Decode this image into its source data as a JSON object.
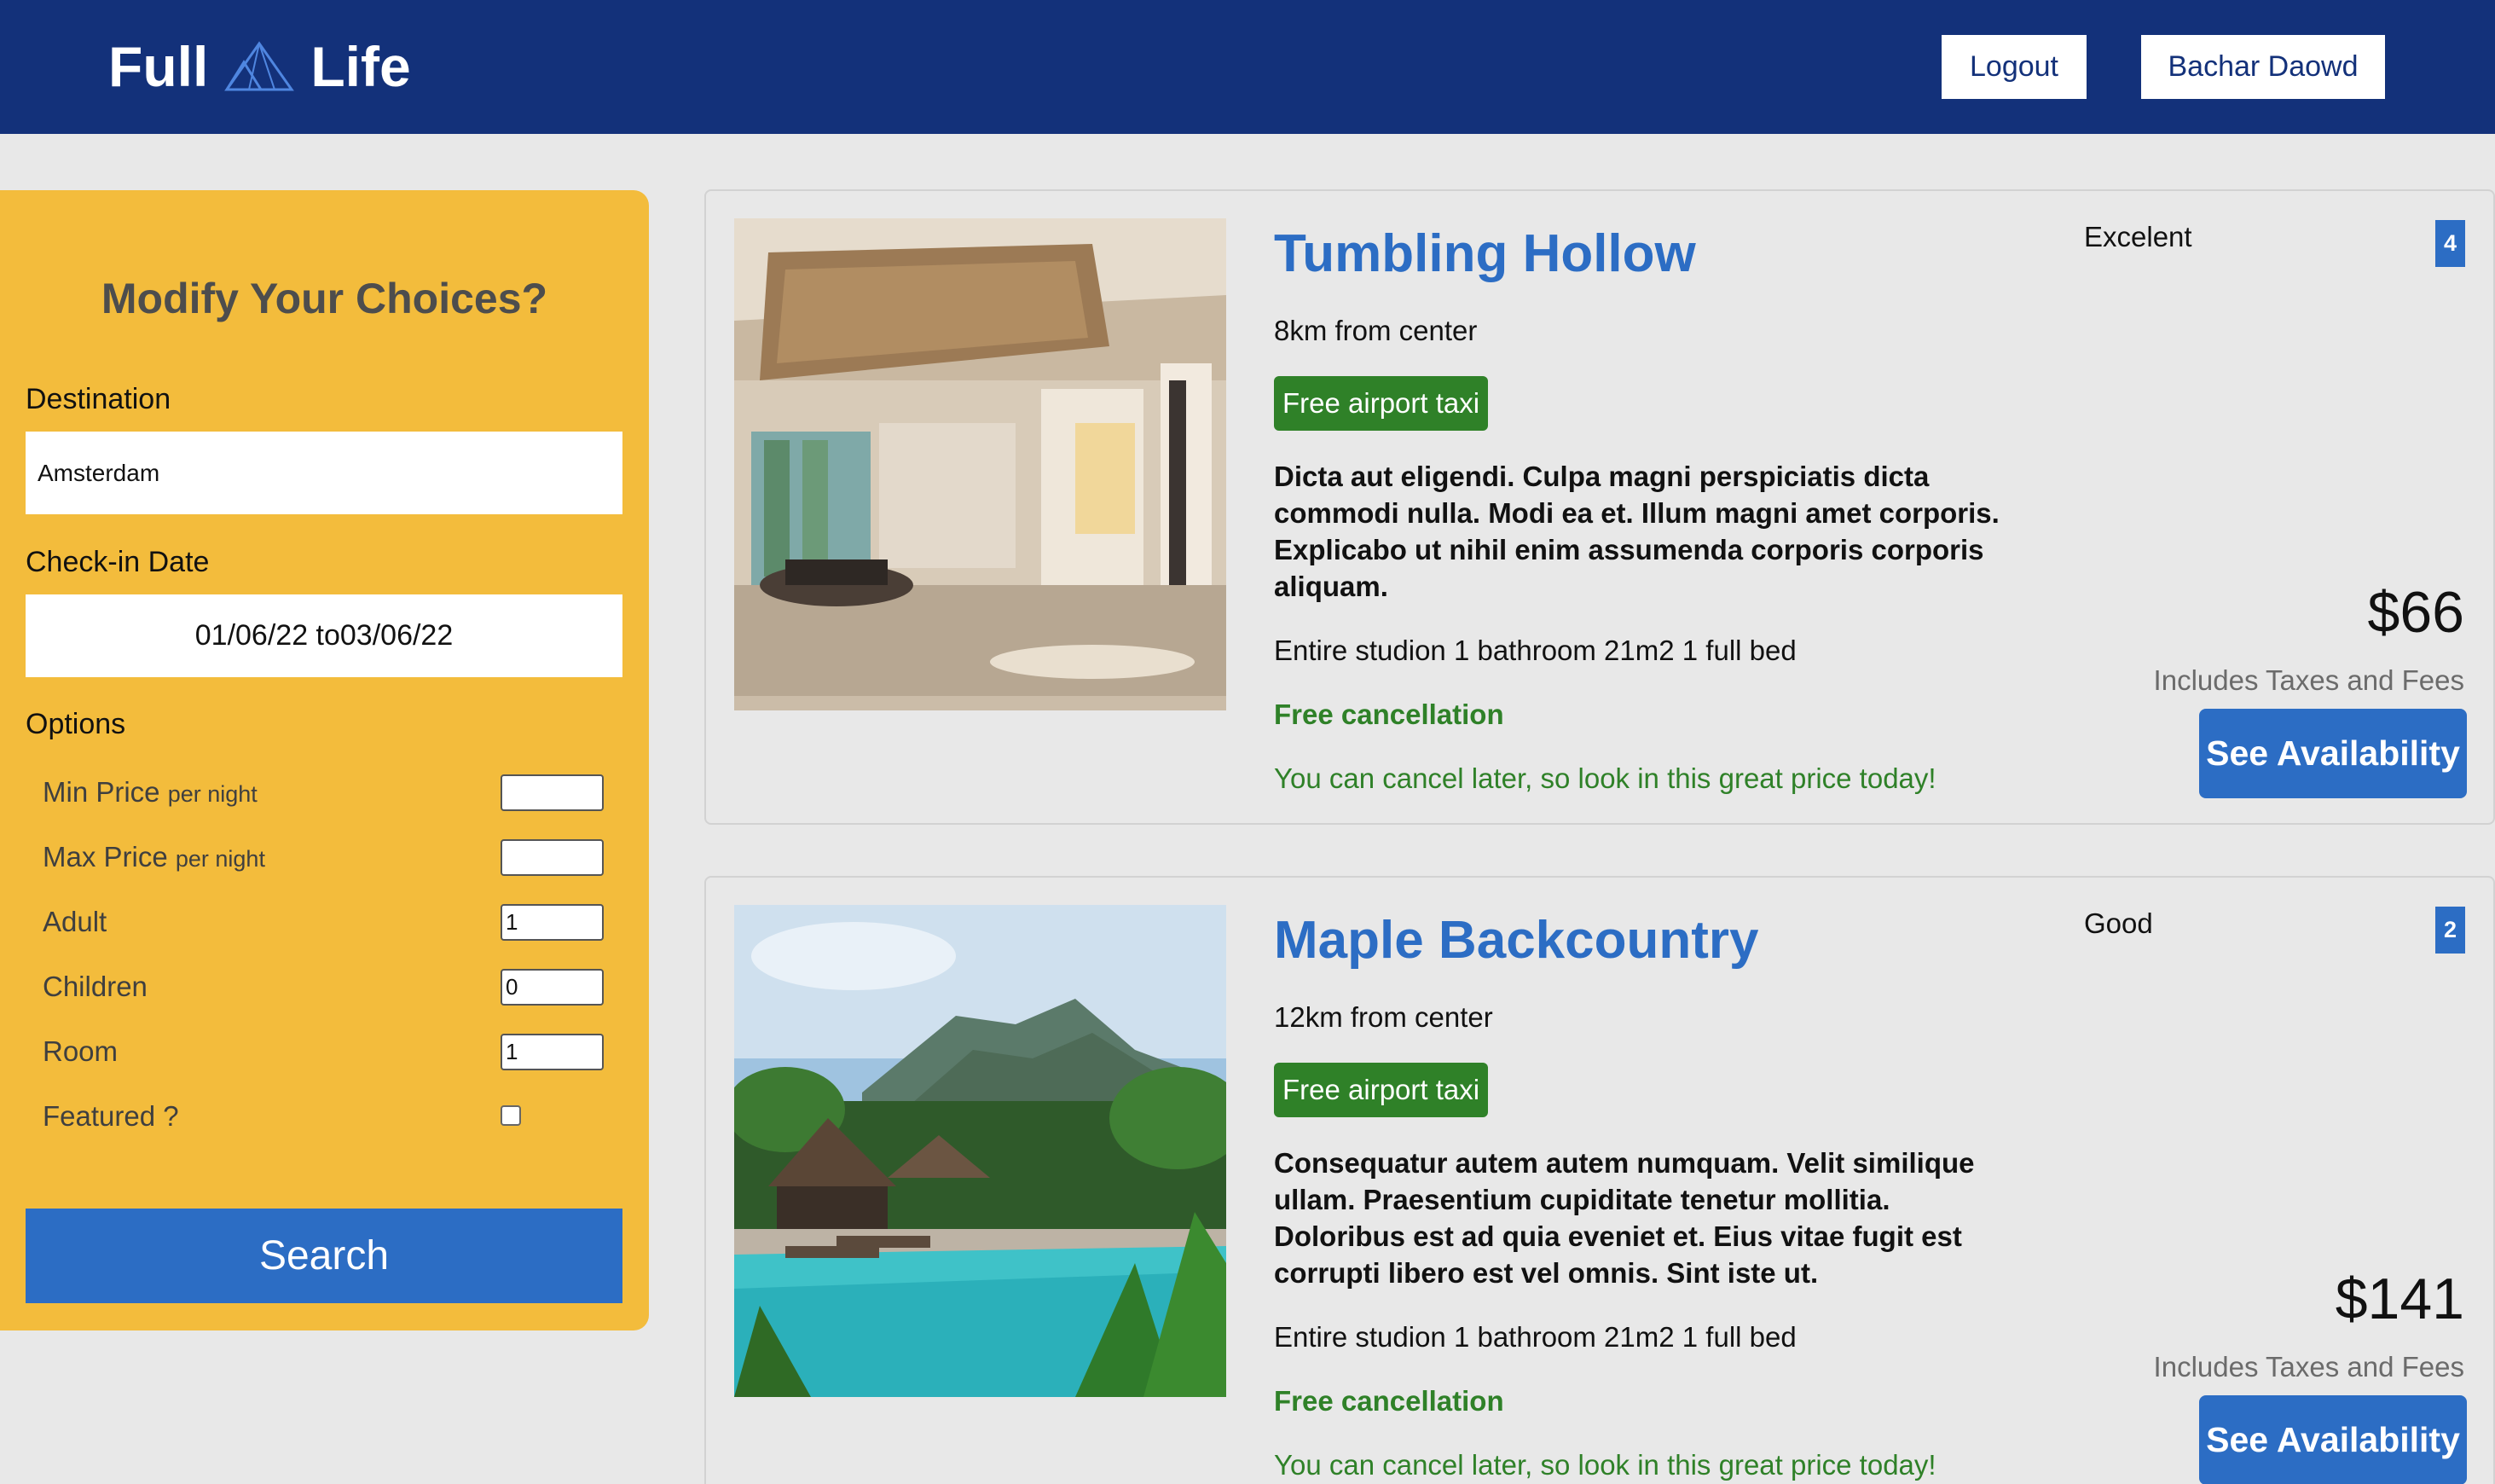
{
  "header": {
    "logo_left": "Full",
    "logo_right": "Life",
    "logout_label": "Logout",
    "user_label": "Bachar Daowd",
    "bg_color": "#13317a"
  },
  "sidebar": {
    "title": "Modify Your Choices?",
    "destination_label": "Destination",
    "destination_value": "Amsterdam",
    "checkin_label": "Check-in Date",
    "checkin_value": "01/06/22 to03/06/22",
    "options_label": "Options",
    "options": [
      {
        "label": "Min Price",
        "suffix": "per night",
        "value": ""
      },
      {
        "label": "Max Price",
        "suffix": "per night",
        "value": ""
      },
      {
        "label": "Adult",
        "value": "1"
      },
      {
        "label": "Children",
        "value": "0"
      },
      {
        "label": "Room",
        "value": "1"
      },
      {
        "label": "Featured ?",
        "checked": false
      }
    ],
    "search_label": "Search",
    "bg_color": "#f3bc3c"
  },
  "results": [
    {
      "name": "Tumbling Hollow",
      "distance": "8km from center",
      "badge": "Free airport taxi",
      "description": "Dicta aut eligendi. Culpa magni perspiciatis dicta commodi nulla. Modi ea et. Illum magni amet corporis. Explicabo ut nihil enim assumenda corporis corporis aliquam.",
      "room": "Entire studion 1 bathroom 21m2 1 full bed",
      "cancellation": "Free cancellation",
      "cancellation_sub": "You can cancel later, so look in this great price today!",
      "rating_text": "Excelent",
      "rating_score": "4",
      "price": "$66",
      "taxes": "Includes Taxes and Fees",
      "availability_label": "See Availability",
      "photo_icon": "hotel-lobby-photo"
    },
    {
      "name": "Maple Backcountry",
      "distance": "12km from center",
      "badge": "Free airport taxi",
      "description": "Consequatur autem autem numquam. Velit similique ullam. Praesentium cupiditate tenetur mollitia. Doloribus est ad quia eveniet et. Eius vitae fugit est corrupti libero est vel omnis. Sint iste ut.",
      "room": "Entire studion 1 bathroom 21m2 1 full bed",
      "cancellation": "Free cancellation",
      "cancellation_sub": "You can cancel later, so look in this great price today!",
      "rating_text": "Good",
      "rating_score": "2",
      "price": "$141",
      "taxes": "Includes Taxes and Fees",
      "availability_label": "See Availability",
      "photo_icon": "tropical-resort-pool-photo"
    }
  ],
  "colors": {
    "accent_blue": "#2c6dc4",
    "badge_green": "#2f8128",
    "page_bg": "#e8e8e8"
  }
}
